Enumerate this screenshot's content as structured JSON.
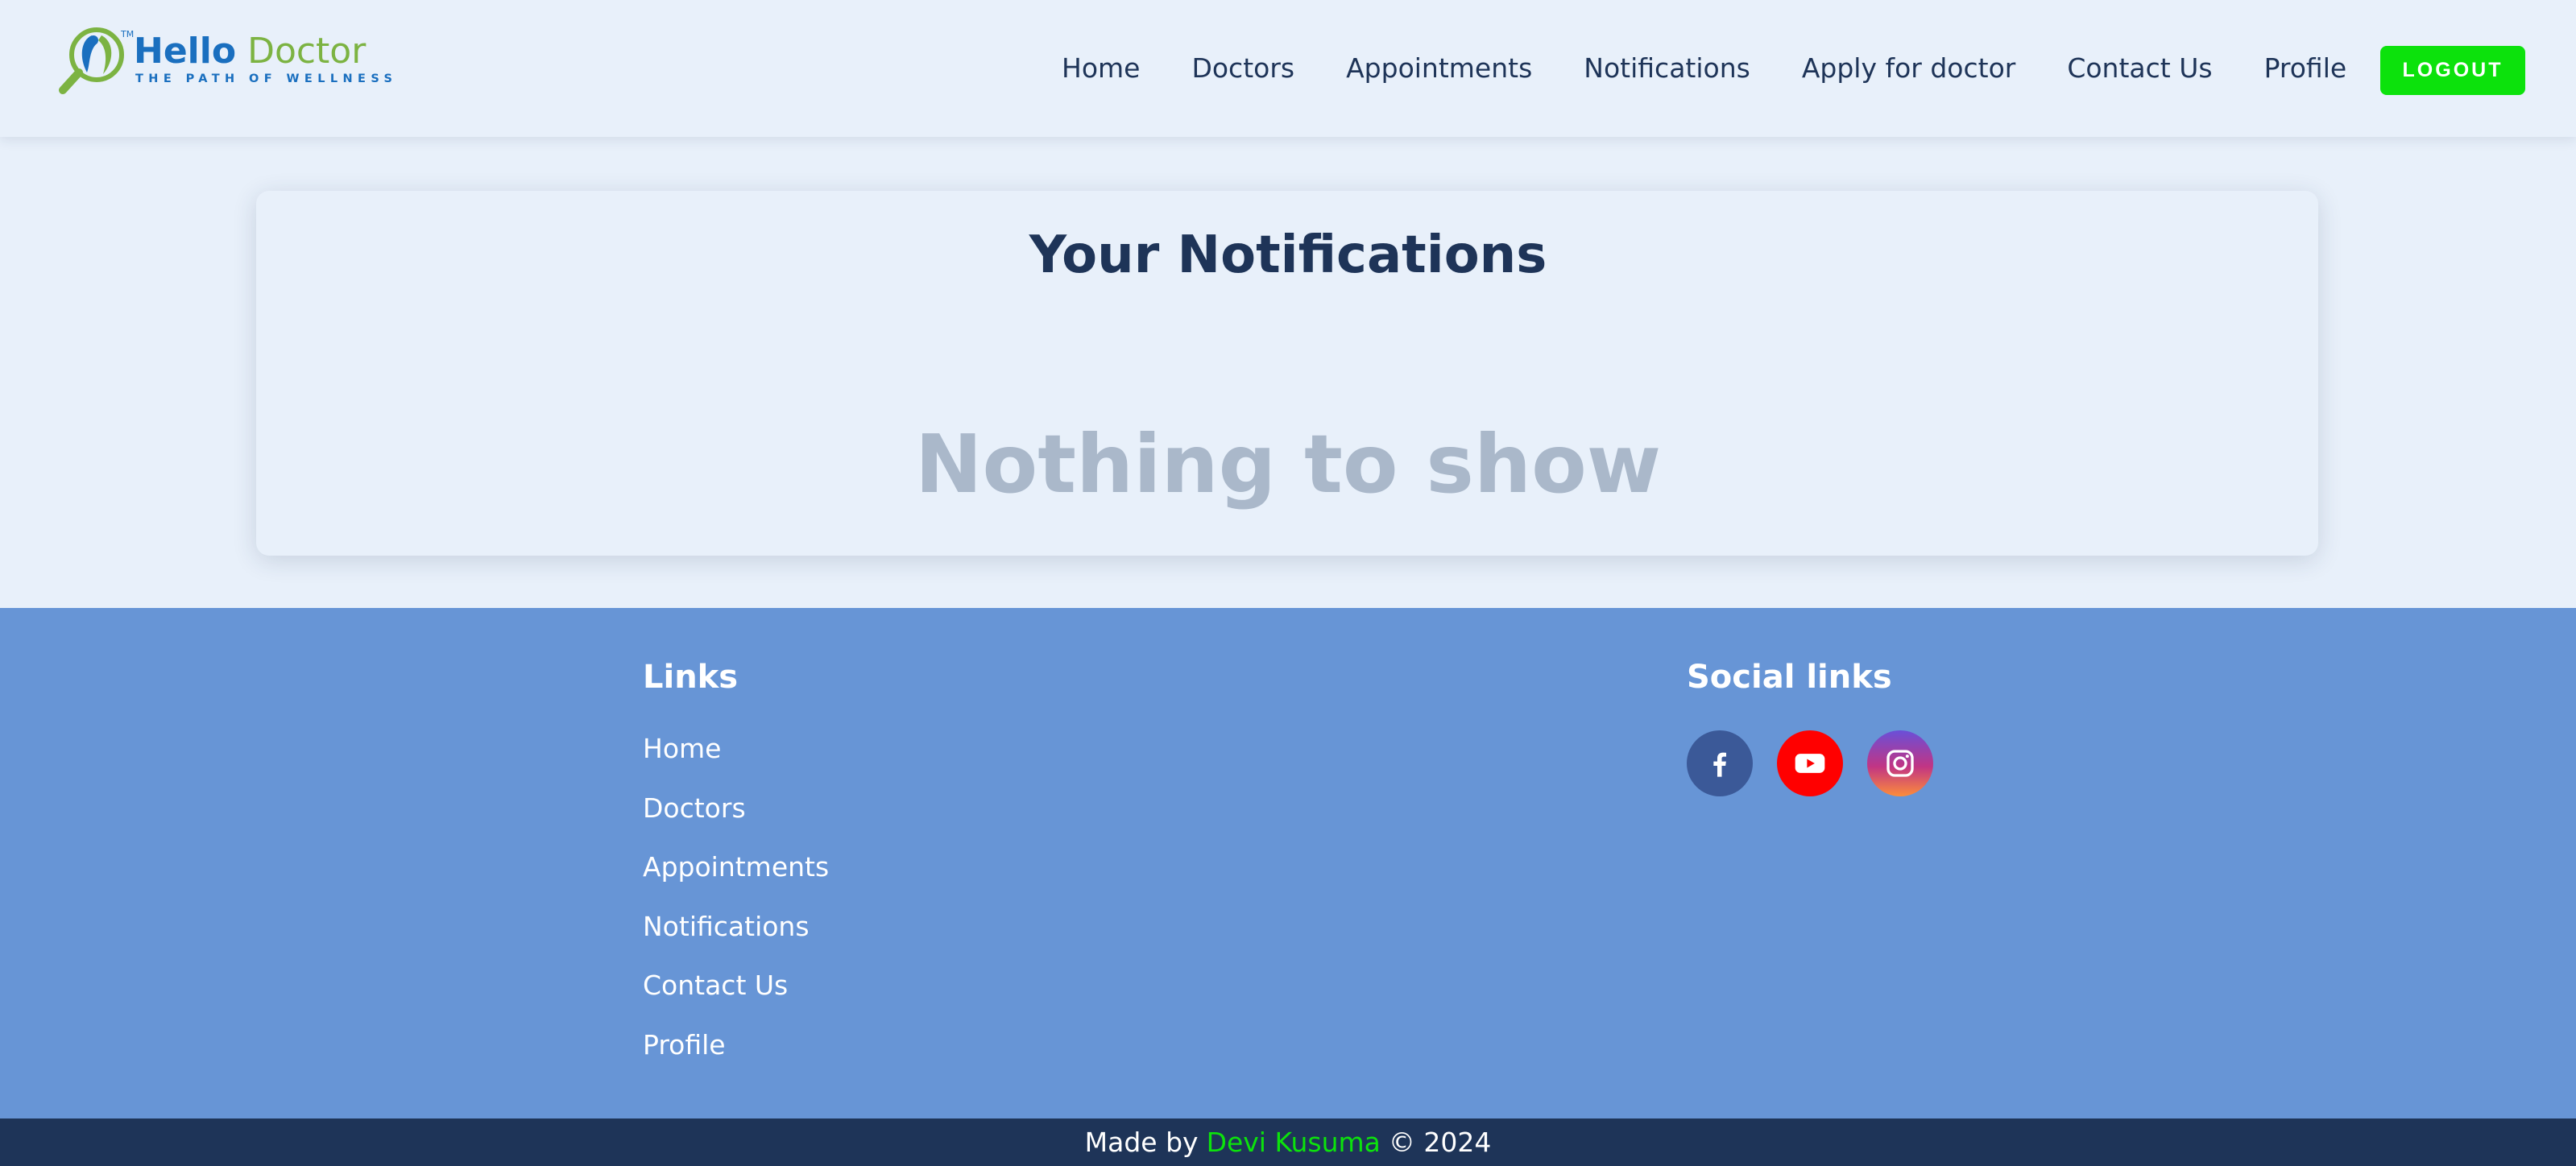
{
  "brand": {
    "name_part1": "Hello",
    "name_part2": "Doctor",
    "tagline": "THE PATH OF WELLNESS",
    "trademark": "TM",
    "colors": {
      "blue": "#1a6fbf",
      "green": "#7cb342"
    }
  },
  "nav": {
    "items": [
      {
        "label": "Home"
      },
      {
        "label": "Doctors"
      },
      {
        "label": "Appointments"
      },
      {
        "label": "Notifications"
      },
      {
        "label": "Apply for doctor"
      },
      {
        "label": "Contact Us"
      },
      {
        "label": "Profile"
      }
    ],
    "logout_label": "LOGOUT"
  },
  "main": {
    "title": "Your Notifications",
    "empty_message": "Nothing to show"
  },
  "footer": {
    "links_heading": "Links",
    "links": [
      {
        "label": "Home"
      },
      {
        "label": "Doctors"
      },
      {
        "label": "Appointments"
      },
      {
        "label": "Notifications"
      },
      {
        "label": "Contact Us"
      },
      {
        "label": "Profile"
      }
    ],
    "social_heading": "Social links",
    "social": [
      {
        "icon": "facebook-icon",
        "color": "#3b5998"
      },
      {
        "icon": "youtube-icon",
        "color": "#ff0000"
      },
      {
        "icon": "instagram-icon",
        "color": "#c13584"
      }
    ],
    "credit_prefix": "Made by",
    "credit_author": "Devi Kusuma",
    "credit_suffix": "© 2024"
  },
  "colors": {
    "background": "#e8f0fa",
    "primary_text": "#1e3458",
    "accent_green": "#0ce20c",
    "footer_bg": "#6795d6",
    "bottom_bar_bg": "#1e3458",
    "empty_text": "#aab8ca"
  }
}
